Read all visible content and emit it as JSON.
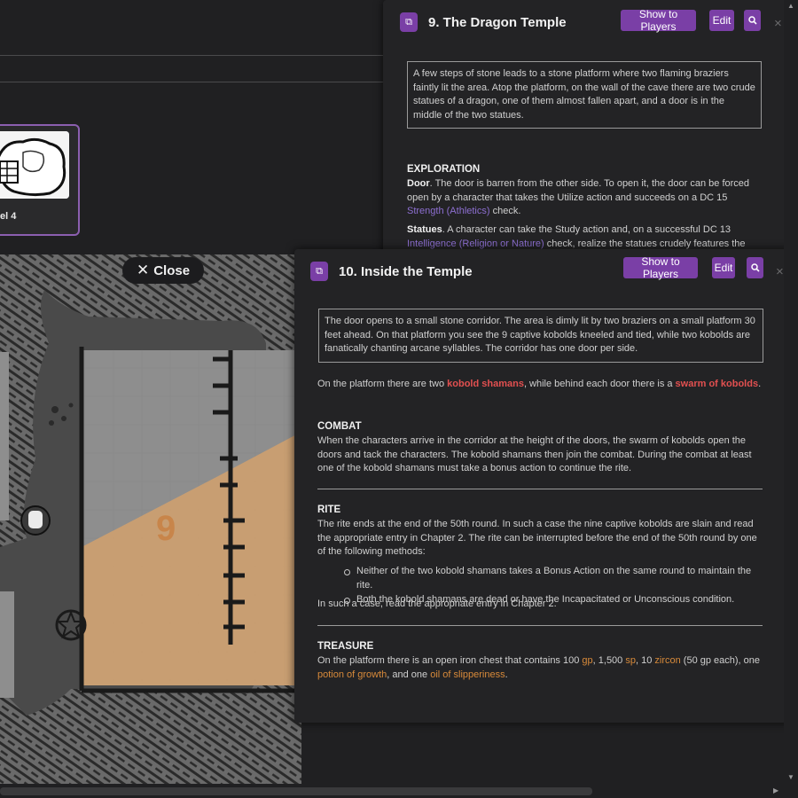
{
  "background": {
    "thumbnail_label": "el 4",
    "map_room_number": "9",
    "close_button_label": "Close"
  },
  "panel_top": {
    "title": "9. The Dragon Temple",
    "show_to_players": "Show to Players",
    "edit": "Edit",
    "read_aloud": "A few steps of stone leads to a stone platform where two flaming braziers faintly lit the area. Atop the platform, on the wall of the cave there are two crude statues of a dragon, one of them almost fallen apart, and a door is in the middle of the two statues.",
    "exploration_heading": "EXPLORATION",
    "door_label": "Door",
    "door_text_a": ". The door is barren from the other side. To open it, the door can be forced open by a character that takes the Utilize action and succeeds on a DC 15 ",
    "door_link": "Strength (Athletics)",
    "door_text_b": " check.",
    "statues_label": "Statues",
    "statues_text_a": ". A character can take the Study action and, on a successful DC 13 ",
    "statues_link": "Intelligence (Religion or Nature)",
    "statues_text_b": " check, realize the statues crudely features the"
  },
  "panel_main": {
    "title": "10. Inside the Temple",
    "show_to_players": "Show to Players",
    "edit": "Edit",
    "read_aloud": "The door opens to a small stone corridor. The area is dimly lit by two braziers on a small platform 30 feet ahead. On that platform you see the 9 captive kobolds kneeled and tied, while two kobolds are fanatically chanting arcane syllables. The corridor has one door per side.",
    "intro_a": "On the platform there are two ",
    "intro_link1": "kobold shamans",
    "intro_b": ", while behind each door there is a ",
    "intro_link2": "swarm of kobolds",
    "intro_c": ".",
    "combat_heading": "COMBAT",
    "combat_text": "When the characters arrive in the corridor at the height of the doors, the swarm of kobolds open the doors and tack the characters. The kobold shamans then join the combat. During the combat at least one of the kobold shamans must take a bonus action to continue the rite.",
    "rite_heading": "RITE",
    "rite_text": "The rite ends at the end of the 50th round. In such a case the nine captive kobolds are slain and read the appropriate entry in Chapter 2. The rite can be interrupted before the end of the 50th round by one of the following methods:",
    "rite_bullets": [
      "Neither of the two kobold shamans takes a Bonus Action on the same round to maintain the rite.",
      "Both the kobold shamans are dead or have the Incapacitated or Unconscious condition."
    ],
    "rite_after": "In such a case, read the appropriate entry in Chapter 2.",
    "treasure_heading": "TREASURE",
    "treasure_a": "On the platform there is an open iron chest that contains 100 ",
    "treasure_gp": "gp",
    "treasure_b": ", 1,500 ",
    "treasure_sp": "sp",
    "treasure_c": ", 10 ",
    "treasure_zircon": "zircon",
    "treasure_d": " (50 gp each), one ",
    "treasure_potion": "potion of growth",
    "treasure_e": ", and one ",
    "treasure_oil": "oil of slipperiness",
    "treasure_f": "."
  },
  "colors": {
    "accent_purple": "#7a3fa6",
    "link_purple": "#8d6fd1",
    "monster_red": "#e25050",
    "item_orange": "#d88a3a",
    "panel_bg": "#232325"
  },
  "icons": [
    "map-pin-icon",
    "search-icon",
    "close-icon"
  ]
}
